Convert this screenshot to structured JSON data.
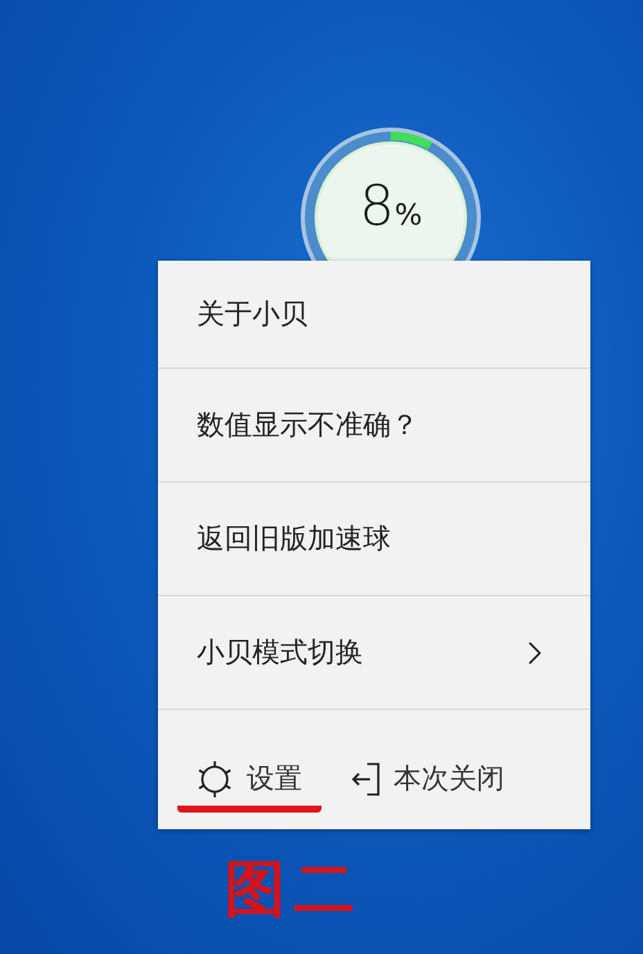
{
  "speed_ball": {
    "value": "8",
    "unit": "%",
    "level": 0.08
  },
  "menu": {
    "items": [
      {
        "label": "关于小贝",
        "kind": "plain"
      },
      {
        "label": "数值显示不准确？",
        "kind": "plain"
      },
      {
        "label": "返回旧版加速球",
        "kind": "plain"
      },
      {
        "label": "小贝模式切换",
        "kind": "submenu"
      }
    ],
    "footer": [
      {
        "label": "设置",
        "kind": "settings",
        "underlined": true
      },
      {
        "label": "本次关闭",
        "kind": "exit",
        "underlined": false
      }
    ]
  },
  "caption": "图二"
}
